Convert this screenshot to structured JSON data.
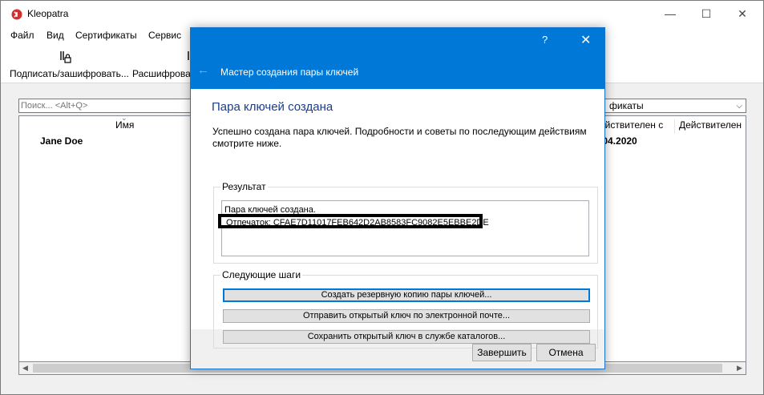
{
  "app": {
    "title": "Kleopatra",
    "window_controls": {
      "minimize": "—",
      "maximize": "☐",
      "close": "✕"
    }
  },
  "menu": [
    "Файл",
    "Вид",
    "Сертификаты",
    "Сервис"
  ],
  "toolbar": {
    "sign_encrypt_label": "Подписать/зашифровать...",
    "decrypt_label": "Расшифровать"
  },
  "search": {
    "placeholder": "Поиск... <Alt+Q>"
  },
  "filter": {
    "value": "фикаты"
  },
  "list": {
    "columns": [
      "Имя",
      "ействителен с",
      "Действителен"
    ],
    "rows": [
      {
        "name": "Jane Doe",
        "valid_from": ".04.2020"
      }
    ]
  },
  "dialog": {
    "help": "?",
    "close": "✕",
    "back": "←",
    "title": "Мастер создания пары ключей",
    "page_title": "Пара ключей создана",
    "intro": "Успешно создана пара ключей. Подробности и советы по последующим действиям смотрите ниже.",
    "result_group": "Результат",
    "result_line": "Пара ключей создана.",
    "fingerprint": "Отпечаток: CFAE7D11017FEB642D2AB8583FC9082E5EBBE2DE",
    "next_steps_group": "Следующие шаги",
    "steps": [
      "Создать резервную копию пары ключей...",
      "Отправить открытый ключ по электронной почте...",
      "Сохранить открытый ключ в службе каталогов..."
    ],
    "finish_label": "Завершить",
    "cancel_label": "Отмена"
  },
  "colors": {
    "accent": "#0078d7",
    "page_title": "#1a3e8c",
    "app_icon": "#d32f2f"
  }
}
